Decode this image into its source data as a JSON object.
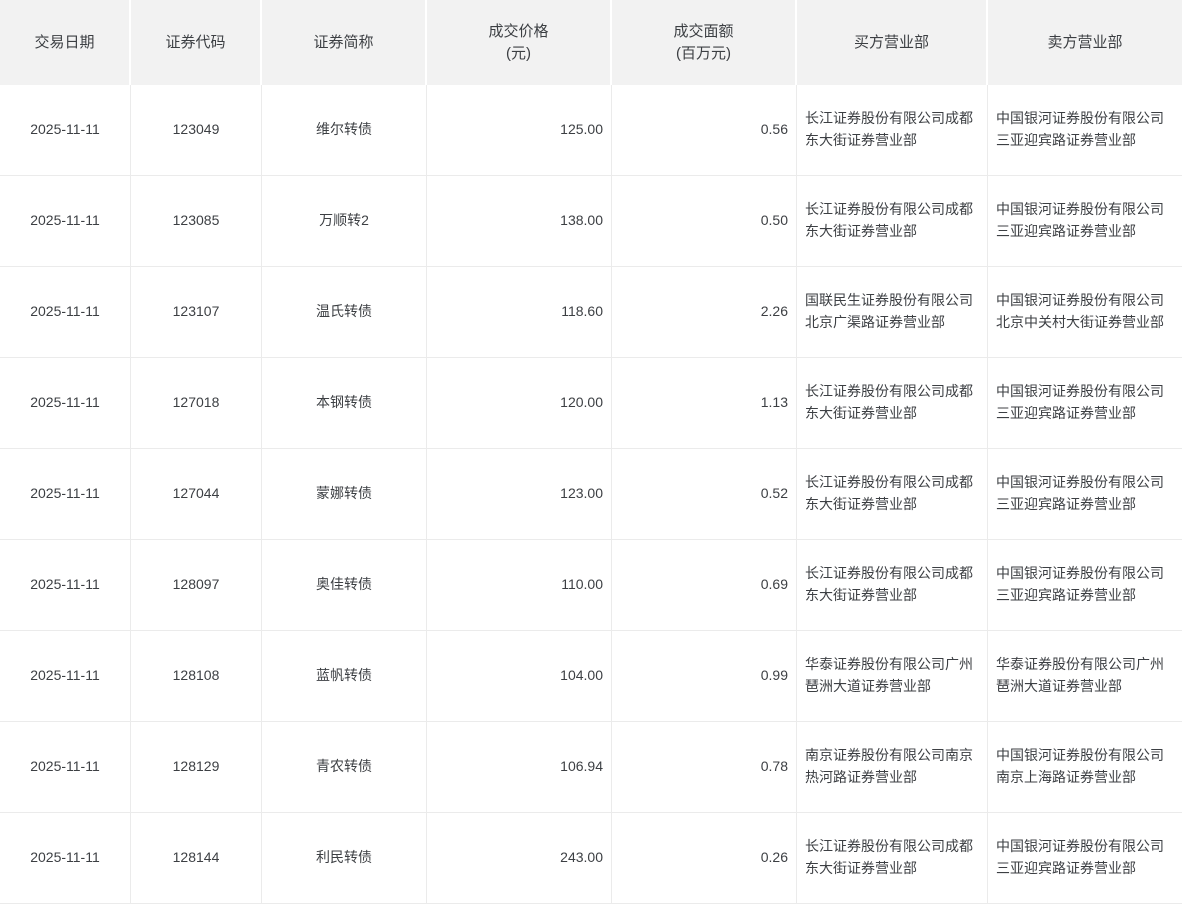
{
  "colors": {
    "header_bg": "#f2f2f2",
    "border": "#ebebeb",
    "text": "#3c3f43"
  },
  "table": {
    "columns": {
      "date": {
        "label": "交易日期",
        "sublabel": ""
      },
      "code": {
        "label": "证券代码",
        "sublabel": ""
      },
      "name": {
        "label": "证券简称",
        "sublabel": ""
      },
      "price": {
        "label": "成交价格",
        "sublabel": "(元)"
      },
      "face": {
        "label": "成交面额",
        "sublabel": "(百万元)"
      },
      "buyer": {
        "label": "买方营业部",
        "sublabel": ""
      },
      "seller": {
        "label": "卖方营业部",
        "sublabel": ""
      }
    },
    "rows": [
      {
        "date": "2025-11-11",
        "code": "123049",
        "name": "维尔转债",
        "price": "125.00",
        "face_value": "0.56",
        "buyer": "长江证券股份有限公司成都东大街证券营业部",
        "seller": "中国银河证券股份有限公司三亚迎宾路证券营业部"
      },
      {
        "date": "2025-11-11",
        "code": "123085",
        "name": "万顺转2",
        "price": "138.00",
        "face_value": "0.50",
        "buyer": "长江证券股份有限公司成都东大街证券营业部",
        "seller": "中国银河证券股份有限公司三亚迎宾路证券营业部"
      },
      {
        "date": "2025-11-11",
        "code": "123107",
        "name": "温氏转债",
        "price": "118.60",
        "face_value": "2.26",
        "buyer": "国联民生证券股份有限公司北京广渠路证券营业部",
        "seller": "中国银河证券股份有限公司北京中关村大街证券营业部"
      },
      {
        "date": "2025-11-11",
        "code": "127018",
        "name": "本钢转债",
        "price": "120.00",
        "face_value": "1.13",
        "buyer": "长江证券股份有限公司成都东大街证券营业部",
        "seller": "中国银河证券股份有限公司三亚迎宾路证券营业部"
      },
      {
        "date": "2025-11-11",
        "code": "127044",
        "name": "蒙娜转债",
        "price": "123.00",
        "face_value": "0.52",
        "buyer": "长江证券股份有限公司成都东大街证券营业部",
        "seller": "中国银河证券股份有限公司三亚迎宾路证券营业部"
      },
      {
        "date": "2025-11-11",
        "code": "128097",
        "name": "奥佳转债",
        "price": "110.00",
        "face_value": "0.69",
        "buyer": "长江证券股份有限公司成都东大街证券营业部",
        "seller": "中国银河证券股份有限公司三亚迎宾路证券营业部"
      },
      {
        "date": "2025-11-11",
        "code": "128108",
        "name": "蓝帆转债",
        "price": "104.00",
        "face_value": "0.99",
        "buyer": "华泰证券股份有限公司广州琶洲大道证券营业部",
        "seller": "华泰证券股份有限公司广州琶洲大道证券营业部"
      },
      {
        "date": "2025-11-11",
        "code": "128129",
        "name": "青农转债",
        "price": "106.94",
        "face_value": "0.78",
        "buyer": "南京证券股份有限公司南京热河路证券营业部",
        "seller": "中国银河证券股份有限公司南京上海路证券营业部"
      },
      {
        "date": "2025-11-11",
        "code": "128144",
        "name": "利民转债",
        "price": "243.00",
        "face_value": "0.26",
        "buyer": "长江证券股份有限公司成都东大街证券营业部",
        "seller": "中国银河证券股份有限公司三亚迎宾路证券营业部"
      }
    ]
  }
}
